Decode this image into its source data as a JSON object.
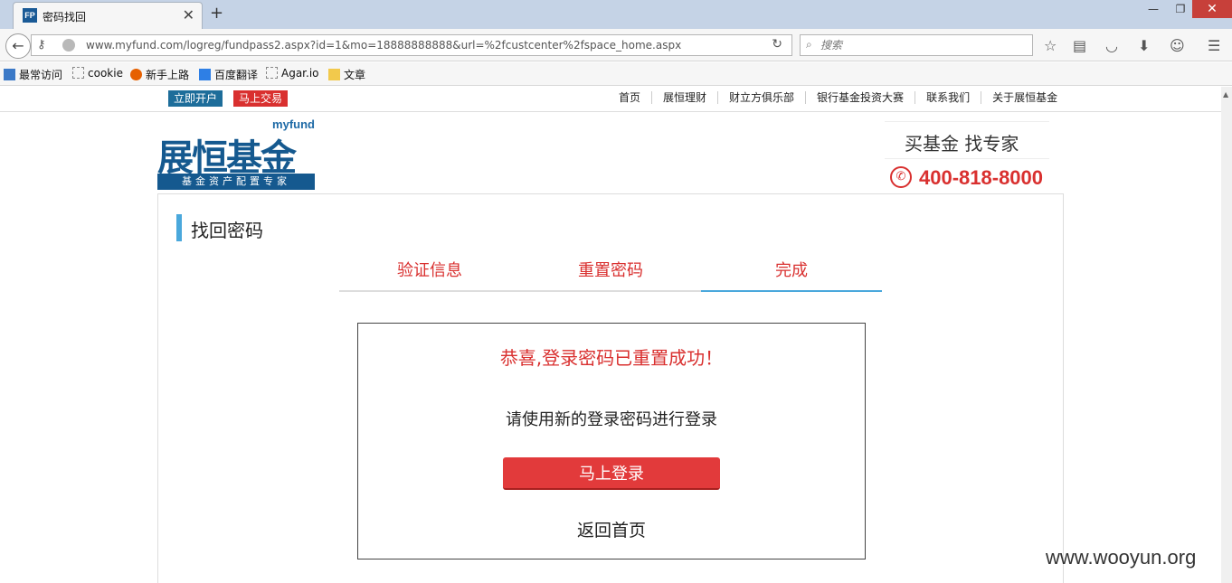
{
  "browser": {
    "tab_title": "密码找回",
    "favicon_text": "FP",
    "url": "www.myfund.com/logreg/fundpass2.aspx?id=1&mo=18888888888&url=%2fcustcenter%2fspace_home.aspx",
    "search_placeholder": "搜索",
    "bookmarks": [
      "最常访问",
      "cookie",
      "新手上路",
      "百度翻译",
      "Agar.io",
      "文章"
    ]
  },
  "site": {
    "top_buttons": {
      "open_account": "立即开户",
      "trade_now": "马上交易"
    },
    "top_nav": [
      "首页",
      "展恒理财",
      "财立方俱乐部",
      "银行基金投资大赛",
      "联系我们",
      "关于展恒基金"
    ],
    "logo": {
      "myfund": "myfund",
      "name": "展恒基金",
      "slogan": "基金资产配置专家"
    },
    "slogan": "买基金 找专家",
    "phone": "400-818-8000"
  },
  "main": {
    "section_title": "找回密码",
    "steps": [
      "验证信息",
      "重置密码",
      "完成"
    ],
    "active_step": 3,
    "success_message": "恭喜,登录密码已重置成功！",
    "info_message": "请使用新的登录密码进行登录",
    "login_button": "马上登录",
    "home_link": "返回首页"
  },
  "watermark": "www.wooyun.org",
  "colors": {
    "brand_blue": "#15598f",
    "accent_red": "#d9302f",
    "step_active": "#4aa8dc"
  }
}
